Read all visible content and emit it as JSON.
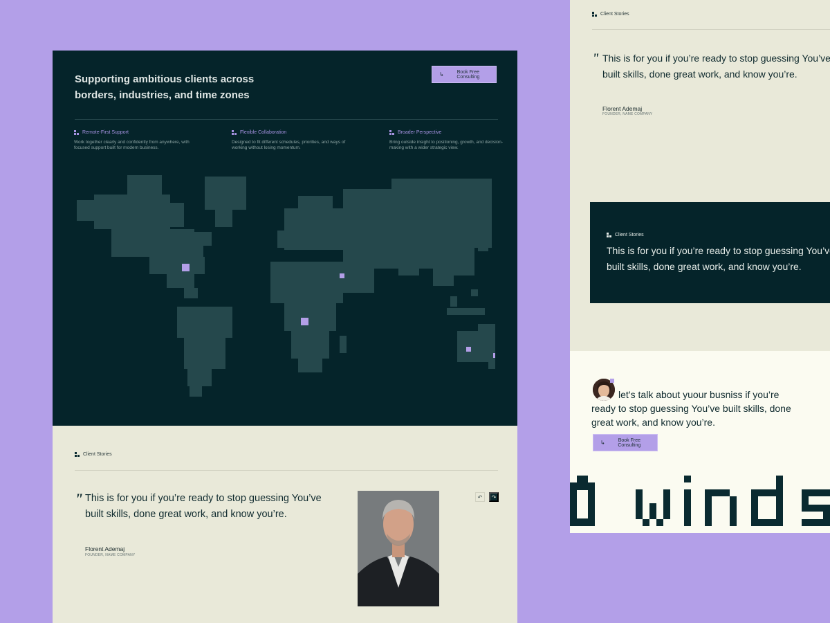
{
  "main": {
    "headline": "Supporting ambitious clients across borders, industries, and time zones",
    "cta_label": "Book Free Consulting",
    "features": [
      {
        "title": "Remote-First Support",
        "desc": "Work together clearly and confidently from anywhere, with focused support built for modern business."
      },
      {
        "title": "Flexible Collaboration",
        "desc": "Designed to fit different schedules, priorities, and ways of working without losing momentum."
      },
      {
        "title": "Broader Perspective",
        "desc": "Bring outside insight to positioning, growth, and decision-making with a wider strategic view."
      }
    ],
    "stories": {
      "tag": "Client Stories",
      "quote_mark": "\"",
      "quote": "This is for you if you’re ready to stop guessing You’ve built skills, done great work, and know you’re.",
      "author": "Florent Ademaj",
      "role": "FOUNDER, NAME COMPANY"
    }
  },
  "right": {
    "story_card": {
      "tag": "Client Stories",
      "quote_mark": "\"",
      "quote_line1": "This is for you if you’re ready to stop guessing You’ve",
      "quote_line2": "built skills, done great work, and know you’re.",
      "author": "Florent Ademaj",
      "role": "FOUNDER, NAME COMPANY"
    },
    "dark_card": {
      "tag": "Client Stories",
      "quote_line1": "This is for you if you’re ready to stop guessing You’ve",
      "quote_line2": "built skills, done great work, and know you’re."
    },
    "cta_card": {
      "text": "let’s talk about yuour busniss if you’re ready to stop guessing You’ve built skills, done great work, and know you’re.",
      "cta_label": "Book Free Consulting"
    }
  },
  "icons": {
    "cta_arrow": "arrow-down-right-icon",
    "prev": "undo-arrow-icon",
    "next": "redo-arrow-icon",
    "logo": "pixel-logo-icon"
  },
  "colors": {
    "background": "#b39fe8",
    "dark": "#05242a",
    "land": "#25484c",
    "accent": "#b39fe8",
    "light": "#e9e9d9",
    "cream": "#fbfbf1"
  }
}
